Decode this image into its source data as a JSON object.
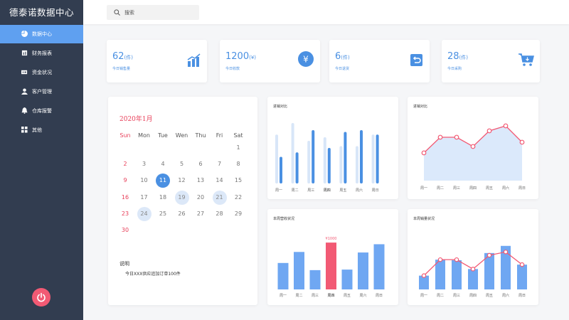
{
  "app": {
    "title": "德泰诺数据中心"
  },
  "sidebar": {
    "items": [
      {
        "label": "数据中心",
        "icon": "pie-chart-icon"
      },
      {
        "label": "财务报表",
        "icon": "report-icon"
      },
      {
        "label": "资金状况",
        "icon": "money-icon"
      },
      {
        "label": "客户管理",
        "icon": "user-icon"
      },
      {
        "label": "仓库报警",
        "icon": "bell-icon"
      },
      {
        "label": "其他",
        "icon": "grid-icon"
      }
    ],
    "active_index": 0
  },
  "search": {
    "placeholder": "搜索"
  },
  "stats": [
    {
      "value": "62",
      "unit": "(件)",
      "label": "今日销售量",
      "icon": "bar-chart-icon"
    },
    {
      "value": "1200",
      "unit": "(¥)",
      "label": "今日收款",
      "icon": "yen-icon"
    },
    {
      "value": "6",
      "unit": "(件)",
      "label": "今日退货",
      "icon": "return-icon"
    },
    {
      "value": "28",
      "unit": "(件)",
      "label": "今日采购",
      "icon": "cart-icon"
    }
  ],
  "calendar": {
    "title": "2020年1月",
    "weekdays": [
      "Sun",
      "Mon",
      "Tue",
      "Wen",
      "Thu",
      "Fri",
      "Sat"
    ],
    "days_in_month": 30,
    "first_weekday": 6,
    "today": 11,
    "marked_days": [
      19,
      21,
      24
    ],
    "note_title": "说明",
    "note_text": "今日XXX供应追加订单100件"
  },
  "colors": {
    "accent": "#4a90e2",
    "bar_light": "#d8e6f8",
    "highlight": "#f25a74",
    "area": "#dbe9fb"
  },
  "chart_data": [
    {
      "type": "bar",
      "title": "进销对比",
      "categories": [
        "周一",
        "周二",
        "周三",
        "周四",
        "周五",
        "周六",
        "周日"
      ],
      "series": [
        {
          "values": [
            55,
            68,
            48,
            52,
            42,
            42,
            55
          ]
        },
        {
          "values": [
            30,
            35,
            60,
            40,
            58,
            60,
            55
          ]
        }
      ],
      "highlight_category": "周四"
    },
    {
      "type": "area",
      "title": "进销对比",
      "categories": [
        "周一",
        "周二",
        "周三",
        "周四",
        "周五",
        "周六",
        "周日"
      ],
      "values": [
        30,
        52,
        52,
        39,
        61,
        68,
        45
      ]
    },
    {
      "type": "bar",
      "title": "本周营收状况",
      "categories": [
        "周一",
        "周二",
        "周三",
        "周四",
        "周五",
        "周六",
        "周日"
      ],
      "values": [
        48,
        68,
        35,
        85,
        36,
        67,
        82
      ],
      "highlight_index": 3,
      "highlight_label": "¥1000"
    },
    {
      "type": "bar",
      "title": "本周销量状况",
      "categories": [
        "周一",
        "周二",
        "周三",
        "周四",
        "周五",
        "周六",
        "周日"
      ],
      "values": [
        25,
        54,
        53,
        37,
        66,
        79,
        45
      ],
      "line": [
        25,
        54,
        54,
        37,
        62,
        68,
        45
      ]
    }
  ]
}
